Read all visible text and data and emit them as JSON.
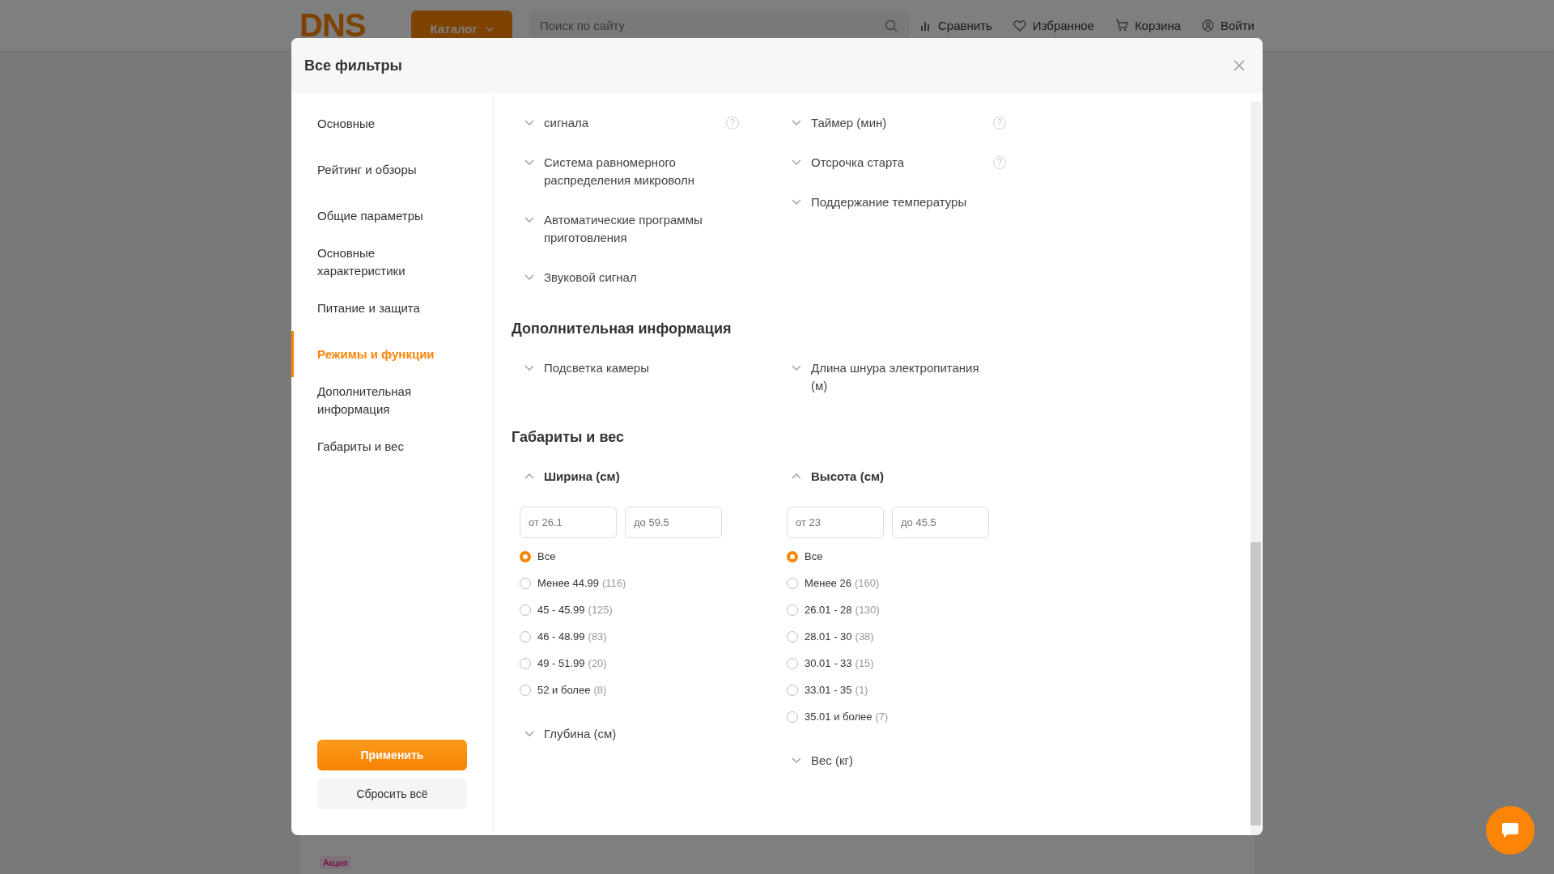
{
  "background_page": {
    "logo": "DNS",
    "catalog_button": "Каталог",
    "search": {
      "placeholder": "Поиск по сайту"
    },
    "nav": [
      {
        "label": "Сравнить",
        "kind": "compare"
      },
      {
        "label": "Избранное",
        "kind": "favorites"
      },
      {
        "label": "Корзина",
        "kind": "cart"
      },
      {
        "label": "Войти",
        "kind": "login"
      }
    ],
    "promo_tag": "Акция"
  },
  "modal": {
    "title": "Все фильтры",
    "sidebar": {
      "items": [
        {
          "label": "Основные",
          "selected": false
        },
        {
          "label": "Рейтинг и обзоры",
          "selected": false
        },
        {
          "label": "Общие параметры",
          "selected": false
        },
        {
          "label": "Основные характеристики",
          "selected": false
        },
        {
          "label": "Питание и защита",
          "selected": false
        },
        {
          "label": "Режимы и функции",
          "selected": true
        },
        {
          "label": "Дополнительная информация",
          "selected": false
        },
        {
          "label": "Габариты и вес",
          "selected": false
        }
      ]
    },
    "apply_button": "Применить",
    "reset_button": "Сбросить всё",
    "sections": [
      {
        "columns": [
          [
            {
              "label": "сигнала",
              "expanded": false,
              "help": "?"
            },
            {
              "label": "Система равномерного распределения микроволн",
              "expanded": false
            },
            {
              "label": "Автоматические программы приготовления",
              "expanded": false
            },
            {
              "label": "Звуковой сигнал",
              "expanded": false
            }
          ],
          [
            {
              "label": "Таймер (мин)",
              "expanded": false,
              "help": "?"
            },
            {
              "label": "Отсрочка старта",
              "expanded": false,
              "help": "?"
            },
            {
              "label": "Поддержание температуры",
              "expanded": false
            }
          ]
        ]
      },
      {
        "title": "Дополнительная информация",
        "columns": [
          [
            {
              "label": "Подсветка камеры",
              "expanded": false
            }
          ],
          [
            {
              "label": "Длина шнура электропитания (м)",
              "expanded": false
            }
          ]
        ]
      },
      {
        "title": "Габариты и вес",
        "columns": [
          [
            {
              "label": "Ширина (см)",
              "expanded": true,
              "range": [
                {
                  "placeholder": "от 26.1"
                },
                {
                  "placeholder": "до 59.5"
                }
              ],
              "options": [
                {
                  "label": "Все",
                  "selected": true
                },
                {
                  "label": "Менее 44.99",
                  "count": "(116)",
                  "selected": false
                },
                {
                  "label": "45 - 45.99",
                  "count": "(125)",
                  "selected": false
                },
                {
                  "label": "46 - 48.99",
                  "count": "(83)",
                  "selected": false
                },
                {
                  "label": "49 - 51.99",
                  "count": "(20)",
                  "selected": false
                },
                {
                  "label": "52 и более",
                  "count": "(8)",
                  "selected": false
                }
              ]
            },
            {
              "label": "Глубина (см)",
              "expanded": false
            }
          ],
          [
            {
              "label": "Высота (см)",
              "expanded": true,
              "range": [
                {
                  "placeholder": "от 23"
                },
                {
                  "placeholder": "до 45.5"
                }
              ],
              "options": [
                {
                  "label": "Все",
                  "selected": true
                },
                {
                  "label": "Менее 26",
                  "count": "(160)",
                  "selected": false
                },
                {
                  "label": "26.01 - 28",
                  "count": "(130)",
                  "selected": false
                },
                {
                  "label": "28.01 - 30",
                  "count": "(38)",
                  "selected": false
                },
                {
                  "label": "30.01 - 33",
                  "count": "(15)",
                  "selected": false
                },
                {
                  "label": "33.01 - 35",
                  "count": "(1)",
                  "selected": false
                },
                {
                  "label": "35.01 и более",
                  "count": "(7)",
                  "selected": false
                }
              ]
            },
            {
              "label": "Вес (кг)",
              "expanded": false
            }
          ]
        ]
      }
    ]
  }
}
